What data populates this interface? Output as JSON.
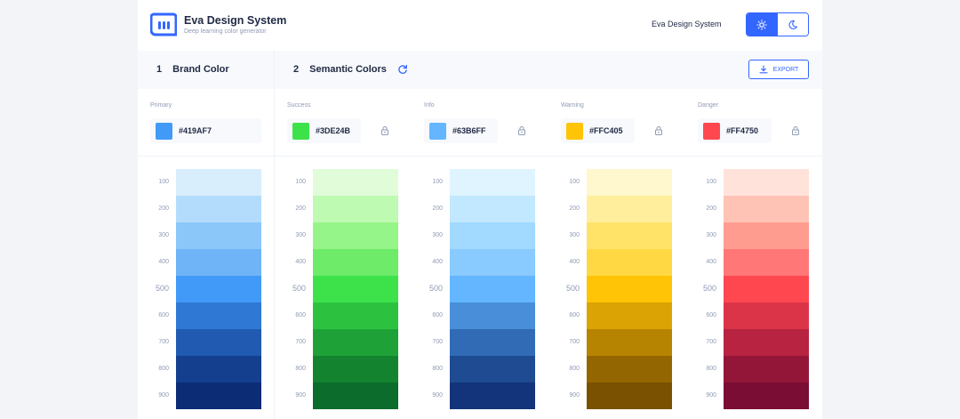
{
  "header": {
    "title": "Eva Design System",
    "subtitle": "Deep learning color generator",
    "right_title": "Eva Design System",
    "theme_light_icon": "sun-icon",
    "theme_dark_icon": "moon-icon",
    "accent": "#3366FF"
  },
  "sections": {
    "brand": {
      "number": "1",
      "label": "Brand Color"
    },
    "semantic": {
      "number": "2",
      "label": "Semantic Colors",
      "refresh_icon": "refresh-icon"
    },
    "export_label": "EXPORT",
    "export_icon": "download-icon"
  },
  "shade_labels": [
    "100",
    "200",
    "300",
    "400",
    "500",
    "600",
    "700",
    "800",
    "900"
  ],
  "palettes": [
    {
      "label": "Primary",
      "hex": "#419AF7",
      "locked": false,
      "shades": [
        "#D9EEFD",
        "#B3DCFC",
        "#8CC7FA",
        "#6FB4F7",
        "#419AF7",
        "#2F78D4",
        "#205AB1",
        "#143F8F",
        "#0C2C76"
      ]
    },
    {
      "label": "Success",
      "hex": "#3DE24B",
      "locked": true,
      "shades": [
        "#E0FCD8",
        "#BEFAB1",
        "#96F588",
        "#6DEB69",
        "#3DE24B",
        "#2CC240",
        "#1EA238",
        "#13832F",
        "#0B6C2B"
      ]
    },
    {
      "label": "Info",
      "hex": "#63B6FF",
      "locked": true,
      "shades": [
        "#DFF4FF",
        "#C1E8FF",
        "#A1D9FF",
        "#89CAFF",
        "#63B6FF",
        "#488ED9",
        "#316BB6",
        "#1F4B92",
        "#13347A"
      ]
    },
    {
      "label": "Warning",
      "hex": "#FFC405",
      "locked": true,
      "shades": [
        "#FFF7CD",
        "#FFEE9B",
        "#FFE369",
        "#FFD844",
        "#FFC405",
        "#DBA303",
        "#B78402",
        "#936601",
        "#7A5100"
      ]
    },
    {
      "label": "Danger",
      "hex": "#FF4750",
      "locked": true,
      "shades": [
        "#FFE3DA",
        "#FFC3B5",
        "#FF9C90",
        "#FF7776",
        "#FF4750",
        "#DB3449",
        "#B72341",
        "#931639",
        "#7A0D33"
      ]
    }
  ]
}
